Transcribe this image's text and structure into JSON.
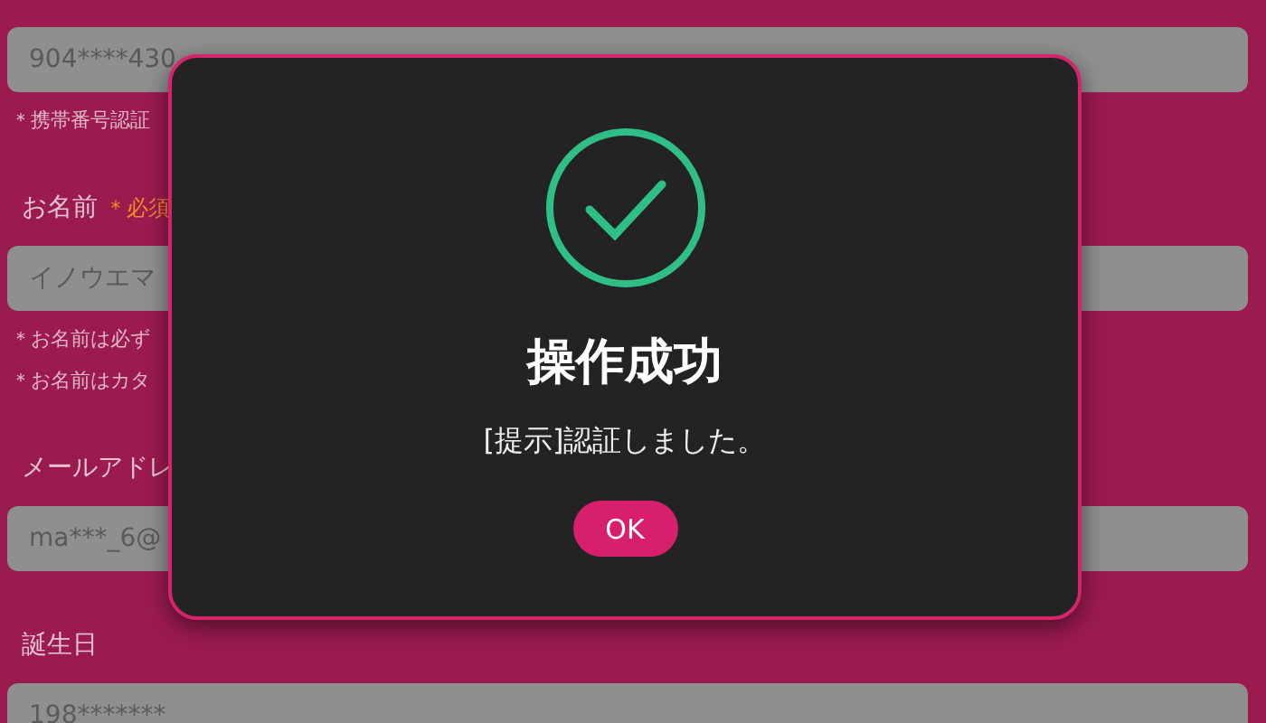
{
  "form": [
    {
      "value": "904****430",
      "notes": [
        "＊携帯番号認証"
      ]
    },
    {
      "label": "お名前",
      "required_mark": "＊必須",
      "value": "イノウエマ",
      "notes": [
        "＊お名前は必ず",
        "＊お名前はカタ"
      ]
    },
    {
      "label": "メールアドレ",
      "value": "ma***_6@"
    },
    {
      "label": "誕生日",
      "value": "198*******"
    }
  ],
  "dialog": {
    "title": "操作成功",
    "message": "[提示]認証しました。",
    "button": "OK"
  }
}
